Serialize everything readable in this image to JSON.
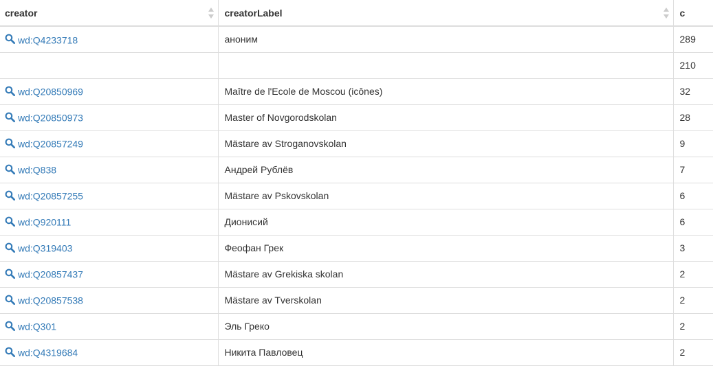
{
  "columns": {
    "creator": "creator",
    "creatorLabel": "creatorLabel",
    "c": "c"
  },
  "colors": {
    "link": "#337ab7",
    "icon": "#337ab7",
    "border": "#dddddd",
    "text": "#333333"
  },
  "icons": {
    "explore": "magnifier-icon",
    "sort": "sort-icon"
  },
  "rows": [
    {
      "creator": "wd:Q4233718",
      "label": "аноним",
      "c": "289"
    },
    {
      "creator": "",
      "label": "",
      "c": "210"
    },
    {
      "creator": "wd:Q20850969",
      "label": "Maître de l'Ecole de Moscou (icônes)",
      "c": "32"
    },
    {
      "creator": "wd:Q20850973",
      "label": "Master of Novgorodskolan",
      "c": "28"
    },
    {
      "creator": "wd:Q20857249",
      "label": "Mästare av Stroganovskolan",
      "c": "9"
    },
    {
      "creator": "wd:Q838",
      "label": "Андрей Рублёв",
      "c": "7"
    },
    {
      "creator": "wd:Q20857255",
      "label": "Mästare av Pskovskolan",
      "c": "6"
    },
    {
      "creator": "wd:Q920111",
      "label": "Дионисий",
      "c": "6"
    },
    {
      "creator": "wd:Q319403",
      "label": "Феофан Грек",
      "c": "3"
    },
    {
      "creator": "wd:Q20857437",
      "label": "Mästare av Grekiska skolan",
      "c": "2"
    },
    {
      "creator": "wd:Q20857538",
      "label": "Mästare av Tverskolan",
      "c": "2"
    },
    {
      "creator": "wd:Q301",
      "label": "Эль Греко",
      "c": "2"
    },
    {
      "creator": "wd:Q4319684",
      "label": "Никита Павловец",
      "c": "2"
    }
  ]
}
